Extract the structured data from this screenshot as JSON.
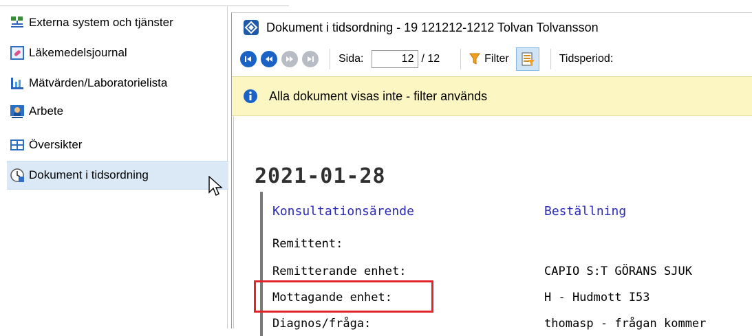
{
  "sidebar": {
    "items": [
      {
        "label": "Externa system och tjänster",
        "icon": "network-icon"
      },
      {
        "label": "Läkemedelsjournal",
        "icon": "medication-journal-icon"
      },
      {
        "label": "Mätvärden/Laboratorielista",
        "icon": "measurements-icon"
      },
      {
        "label": "Arbete",
        "icon": "work-icon"
      },
      {
        "label": "Översikter",
        "icon": "overview-icon"
      },
      {
        "label": "Dokument i tidsordning",
        "icon": "document-timeline-icon",
        "selected": true
      }
    ]
  },
  "window": {
    "title": "Dokument i tidsordning - 19 121212-1212 Tolvan Tolvansson"
  },
  "toolbar": {
    "page_label": "Sida:",
    "page_value": "12",
    "page_total": "/ 12",
    "filter_label": "Filter",
    "period_label": "Tidsperiod:"
  },
  "infobar": {
    "text": "Alla dokument visas inte - filter används"
  },
  "document": {
    "date": "2021-01-28",
    "header": {
      "left": "Konsultationsärende",
      "right": "Beställning"
    },
    "rows": [
      {
        "label": "Remittent:",
        "value": ""
      },
      {
        "label": "Remitterande enhet:",
        "value": "CAPIO S:T GÖRANS SJUK"
      },
      {
        "label": "Mottagande enhet:",
        "value": "H - Hudmott I53"
      },
      {
        "label": "Diagnos/fråga:",
        "value": "thomasp - frågan kommer"
      }
    ]
  },
  "colors": {
    "accent": "#1a62c6",
    "infobar_bg": "#fbf6c2",
    "highlight": "#e0262b",
    "link_blue": "#2a2ab8"
  }
}
